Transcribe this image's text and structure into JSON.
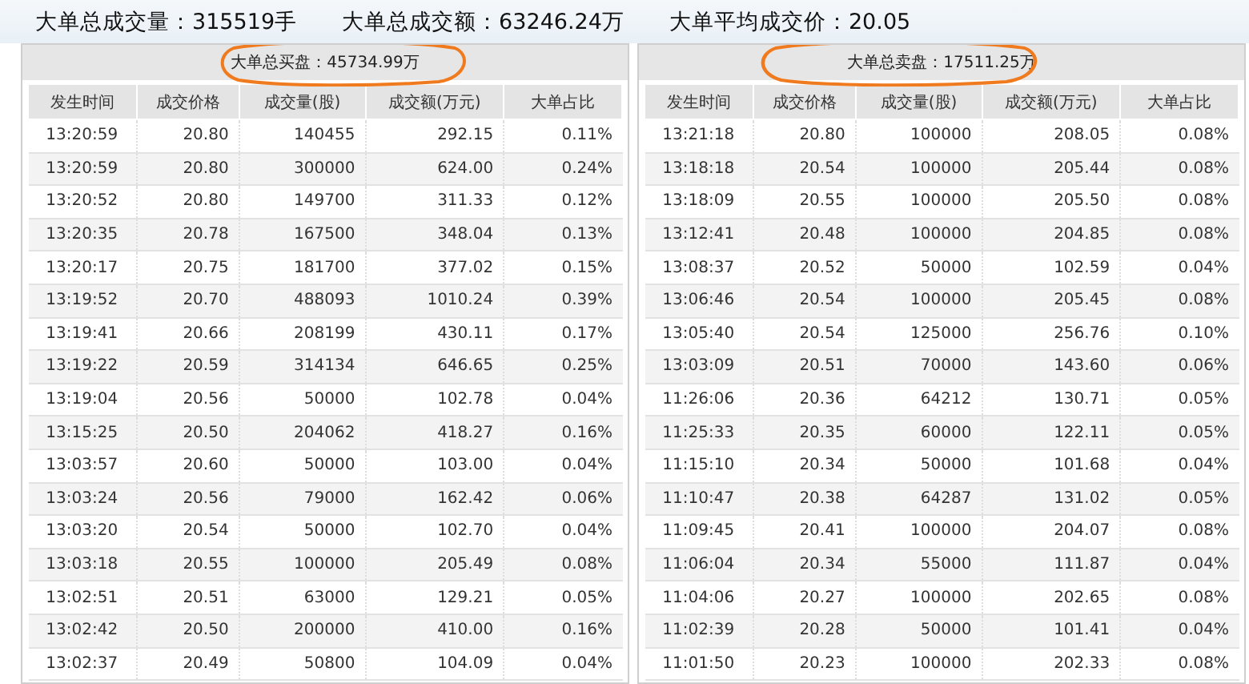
{
  "summary": [
    "大单总成交量：315519手",
    "大单总成交额：63246.24万",
    "大单平均成交价：20.05"
  ],
  "panels": [
    {
      "title": "大单总买盘：45734.99万",
      "highlighted": true,
      "columns": [
        "发生时间",
        "成交价格",
        "成交量(股)",
        "成交额(万元)",
        "大单占比"
      ],
      "rows": [
        [
          "13:20:59",
          "20.80",
          "140455",
          "292.15",
          "0.11%"
        ],
        [
          "13:20:59",
          "20.80",
          "300000",
          "624.00",
          "0.24%"
        ],
        [
          "13:20:52",
          "20.80",
          "149700",
          "311.33",
          "0.12%"
        ],
        [
          "13:20:35",
          "20.78",
          "167500",
          "348.04",
          "0.13%"
        ],
        [
          "13:20:17",
          "20.75",
          "181700",
          "377.02",
          "0.15%"
        ],
        [
          "13:19:52",
          "20.70",
          "488093",
          "1010.24",
          "0.39%"
        ],
        [
          "13:19:41",
          "20.66",
          "208199",
          "430.11",
          "0.17%"
        ],
        [
          "13:19:22",
          "20.59",
          "314134",
          "646.65",
          "0.25%"
        ],
        [
          "13:19:04",
          "20.56",
          "50000",
          "102.78",
          "0.04%"
        ],
        [
          "13:15:25",
          "20.50",
          "204062",
          "418.27",
          "0.16%"
        ],
        [
          "13:03:57",
          "20.60",
          "50000",
          "103.00",
          "0.04%"
        ],
        [
          "13:03:24",
          "20.56",
          "79000",
          "162.42",
          "0.06%"
        ],
        [
          "13:03:20",
          "20.54",
          "50000",
          "102.70",
          "0.04%"
        ],
        [
          "13:03:18",
          "20.55",
          "100000",
          "205.49",
          "0.08%"
        ],
        [
          "13:02:51",
          "20.51",
          "63000",
          "129.21",
          "0.05%"
        ],
        [
          "13:02:42",
          "20.50",
          "200000",
          "410.00",
          "0.16%"
        ],
        [
          "13:02:37",
          "20.49",
          "50800",
          "104.09",
          "0.04%"
        ]
      ]
    },
    {
      "title": "大单总卖盘：17511.25万",
      "highlighted": true,
      "columns": [
        "发生时间",
        "成交价格",
        "成交量(股)",
        "成交额(万元)",
        "大单占比"
      ],
      "rows": [
        [
          "13:21:18",
          "20.80",
          "100000",
          "208.05",
          "0.08%"
        ],
        [
          "13:18:18",
          "20.54",
          "100000",
          "205.44",
          "0.08%"
        ],
        [
          "13:18:09",
          "20.55",
          "100000",
          "205.50",
          "0.08%"
        ],
        [
          "13:12:41",
          "20.48",
          "100000",
          "204.85",
          "0.08%"
        ],
        [
          "13:08:37",
          "20.52",
          "50000",
          "102.59",
          "0.04%"
        ],
        [
          "13:06:46",
          "20.54",
          "100000",
          "205.45",
          "0.08%"
        ],
        [
          "13:05:40",
          "20.54",
          "125000",
          "256.76",
          "0.10%"
        ],
        [
          "13:03:09",
          "20.51",
          "70000",
          "143.60",
          "0.06%"
        ],
        [
          "11:26:06",
          "20.36",
          "64212",
          "130.71",
          "0.05%"
        ],
        [
          "11:25:33",
          "20.35",
          "60000",
          "122.11",
          "0.05%"
        ],
        [
          "11:15:10",
          "20.34",
          "50000",
          "101.68",
          "0.04%"
        ],
        [
          "11:10:47",
          "20.38",
          "64287",
          "131.02",
          "0.05%"
        ],
        [
          "11:09:45",
          "20.41",
          "100000",
          "204.07",
          "0.08%"
        ],
        [
          "11:06:04",
          "20.34",
          "55000",
          "111.87",
          "0.04%"
        ],
        [
          "11:04:06",
          "20.27",
          "100000",
          "202.65",
          "0.08%"
        ],
        [
          "11:02:39",
          "20.28",
          "50000",
          "101.41",
          "0.04%"
        ],
        [
          "11:01:50",
          "20.23",
          "100000",
          "202.33",
          "0.08%"
        ]
      ]
    }
  ]
}
